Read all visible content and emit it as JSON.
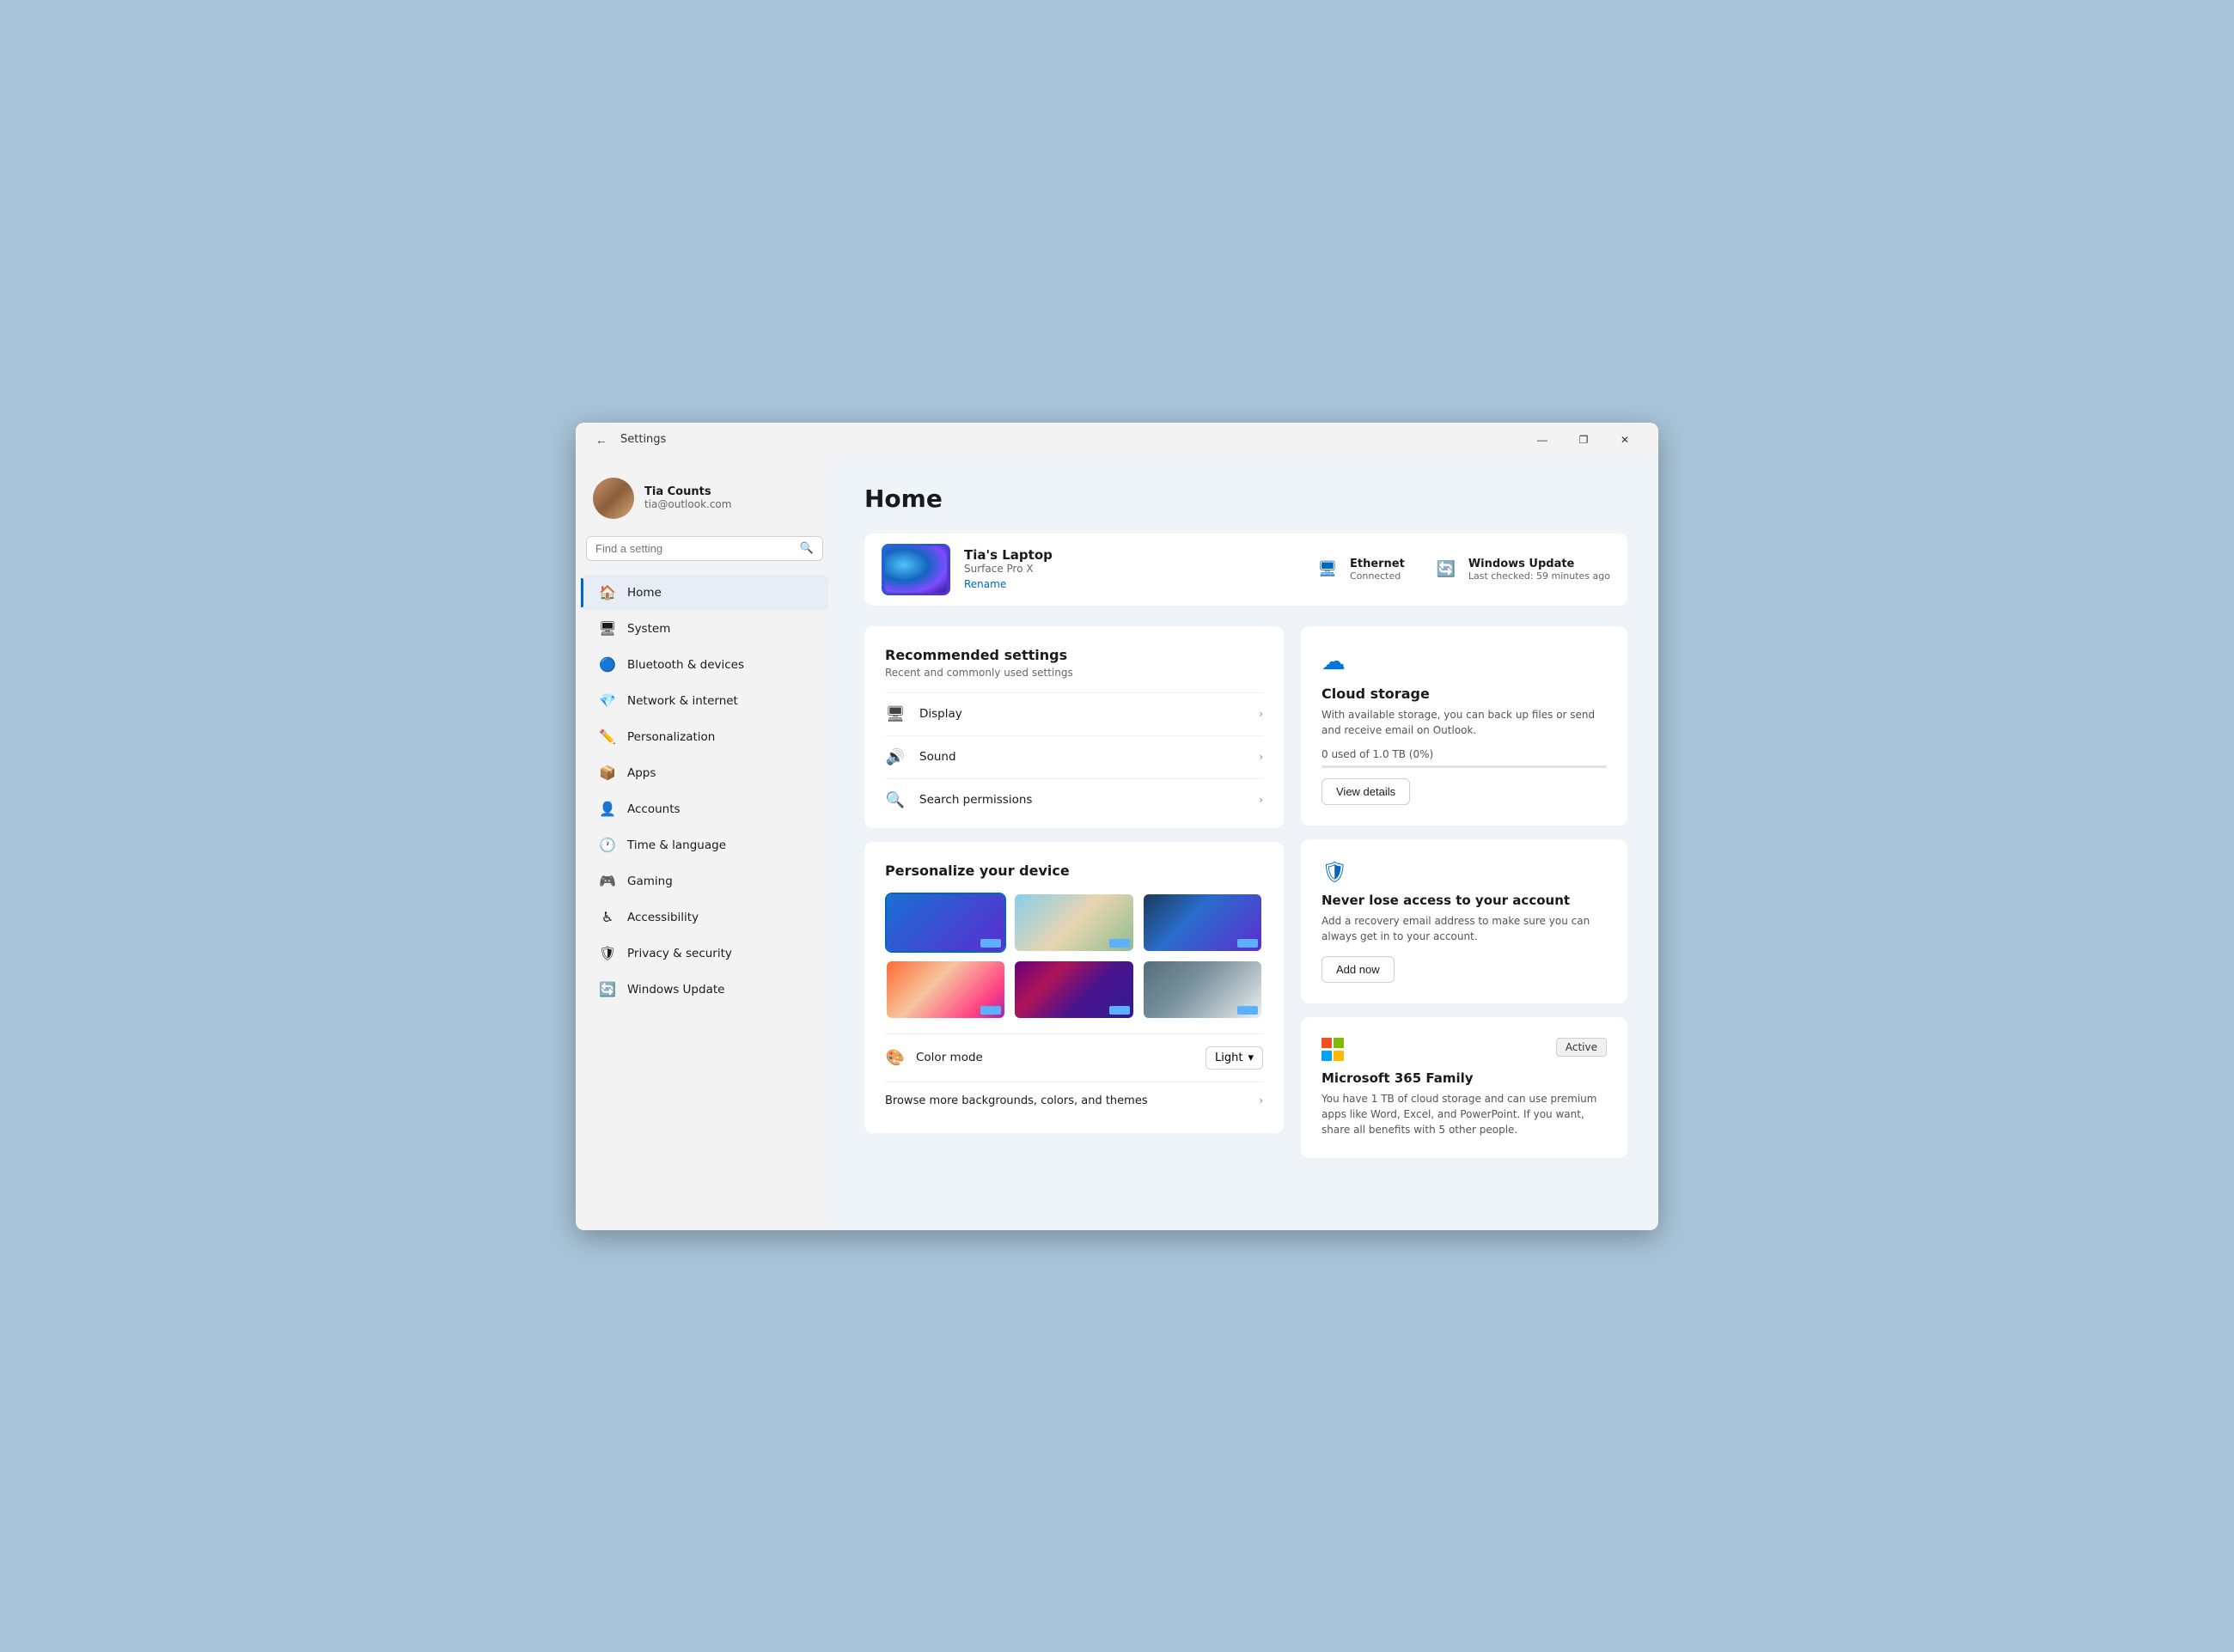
{
  "window": {
    "title": "Settings",
    "back_label": "←",
    "minimize_label": "—",
    "maximize_label": "❐",
    "close_label": "✕"
  },
  "user": {
    "name": "Tia Counts",
    "email": "tia@outlook.com",
    "avatar_emoji": "👩"
  },
  "search": {
    "placeholder": "Find a setting"
  },
  "nav": {
    "items": [
      {
        "id": "home",
        "label": "Home",
        "icon": "🏠",
        "active": true
      },
      {
        "id": "system",
        "label": "System",
        "icon": "🖥"
      },
      {
        "id": "bluetooth",
        "label": "Bluetooth & devices",
        "icon": "🔵"
      },
      {
        "id": "network",
        "label": "Network & internet",
        "icon": "💎"
      },
      {
        "id": "personalization",
        "label": "Personalization",
        "icon": "✏️"
      },
      {
        "id": "apps",
        "label": "Apps",
        "icon": "📦"
      },
      {
        "id": "accounts",
        "label": "Accounts",
        "icon": "👤"
      },
      {
        "id": "time",
        "label": "Time & language",
        "icon": "🕐"
      },
      {
        "id": "gaming",
        "label": "Gaming",
        "icon": "🎮"
      },
      {
        "id": "accessibility",
        "label": "Accessibility",
        "icon": "♿"
      },
      {
        "id": "privacy",
        "label": "Privacy & security",
        "icon": "🛡"
      },
      {
        "id": "update",
        "label": "Windows Update",
        "icon": "🔄"
      }
    ]
  },
  "page": {
    "title": "Home"
  },
  "device": {
    "name": "Tia's Laptop",
    "model": "Surface Pro X",
    "rename_label": "Rename"
  },
  "status_items": [
    {
      "id": "ethernet",
      "label": "Ethernet",
      "sublabel": "Connected",
      "icon": "🖥"
    },
    {
      "id": "update",
      "label": "Windows Update",
      "sublabel": "Last checked: 59 minutes ago",
      "icon": "🔄"
    }
  ],
  "recommended": {
    "title": "Recommended settings",
    "subtitle": "Recent and commonly used settings",
    "items": [
      {
        "id": "display",
        "label": "Display",
        "icon": "🖥"
      },
      {
        "id": "sound",
        "label": "Sound",
        "icon": "🔊"
      },
      {
        "id": "search",
        "label": "Search permissions",
        "icon": "🔍"
      }
    ]
  },
  "personalize": {
    "title": "Personalize your device",
    "color_mode_label": "Color mode",
    "color_mode_value": "Light",
    "color_mode_icon": "🎨",
    "browse_label": "Browse more backgrounds, colors, and themes",
    "wallpapers": [
      {
        "id": "wp1",
        "class": "wp1",
        "selected": true
      },
      {
        "id": "wp2",
        "class": "wp2",
        "selected": false
      },
      {
        "id": "wp3",
        "class": "wp3",
        "selected": false
      },
      {
        "id": "wp4",
        "class": "wp4",
        "selected": false
      },
      {
        "id": "wp5",
        "class": "wp5",
        "selected": false
      },
      {
        "id": "wp6",
        "class": "wp6",
        "selected": false
      }
    ]
  },
  "cloud": {
    "icon": "☁",
    "title": "Cloud storage",
    "description": "With available storage, you can back up files or send and receive email on Outlook.",
    "storage_used": "0 used of 1.0 TB (0%)",
    "storage_pct": 0,
    "view_details_label": "View details"
  },
  "account_security": {
    "title": "Never lose access to your account",
    "description": "Add a recovery email address to make sure you can always get in to your account.",
    "add_label": "Add now"
  },
  "m365": {
    "title": "Microsoft 365 Family",
    "description": "You have 1 TB of cloud storage and can use premium apps like Word, Excel, and PowerPoint. If you want, share all benefits with 5 other people.",
    "badge": "Active",
    "colors": [
      "#f25022",
      "#7fba00",
      "#00a4ef",
      "#ffb900"
    ]
  }
}
